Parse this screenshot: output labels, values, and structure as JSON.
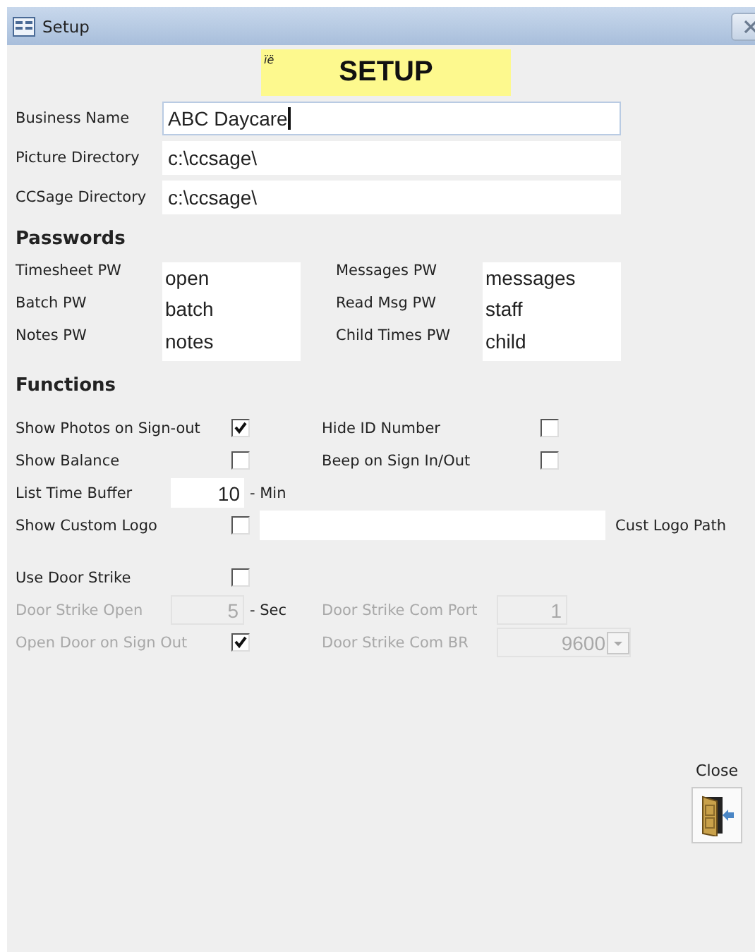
{
  "window": {
    "title": "Setup"
  },
  "header": {
    "mark": "ïë",
    "title": "SETUP"
  },
  "general_fields": [
    {
      "label": "Business Name",
      "value": "ABC Daycare",
      "focused": true
    },
    {
      "label": "Picture Directory",
      "value": "c:\\ccsage\\",
      "focused": false
    },
    {
      "label": "CCSage Directory",
      "value": "c:\\ccsage\\",
      "focused": false
    }
  ],
  "passwords": {
    "heading": "Passwords",
    "left": [
      {
        "label": "Timesheet PW",
        "value": "open"
      },
      {
        "label": "Batch PW",
        "value": "batch"
      },
      {
        "label": "Notes PW",
        "value": "notes"
      }
    ],
    "right": [
      {
        "label": "Messages PW",
        "value": "messages"
      },
      {
        "label": "Read Msg PW",
        "value": "staff"
      },
      {
        "label": "Child Times PW",
        "value": "child"
      }
    ]
  },
  "functions": {
    "heading": "Functions",
    "rows": [
      {
        "left": {
          "kind": "checkbox",
          "label": "Show Photos on Sign-out",
          "checked": true,
          "disabled": false
        },
        "right": {
          "kind": "checkbox",
          "label": "Hide ID Number",
          "checked": false,
          "disabled": false
        }
      },
      {
        "left": {
          "kind": "checkbox",
          "label": "Show Balance",
          "checked": false,
          "disabled": false
        },
        "right": {
          "kind": "checkbox",
          "label": "Beep on Sign In/Out",
          "checked": false,
          "disabled": false
        }
      },
      {
        "left": {
          "kind": "number",
          "label": "List Time Buffer",
          "value": "10",
          "unit": "- Min",
          "disabled": false
        }
      },
      {
        "left": {
          "kind": "logo",
          "label": "Show Custom Logo",
          "checked": false,
          "caption": "Cust Logo Path",
          "disabled": false
        }
      }
    ],
    "door_rows": [
      {
        "left": {
          "kind": "checkbox",
          "label": "Use Door Strike",
          "checked": false,
          "disabled": false
        }
      },
      {
        "left": {
          "kind": "number",
          "label": "Door Strike Open",
          "value": "5",
          "unit": "- Sec",
          "disabled": true
        },
        "right": {
          "kind": "number",
          "label": "Door Strike Com Port",
          "value": "1",
          "disabled": true
        }
      },
      {
        "left": {
          "kind": "checkbox",
          "label": "Open Door on Sign Out",
          "checked": true,
          "disabled": true
        },
        "right": {
          "kind": "combo",
          "label": "Door Strike Com BR",
          "value": "9600",
          "disabled": true
        }
      }
    ]
  },
  "close_button": {
    "label": "Close"
  }
}
